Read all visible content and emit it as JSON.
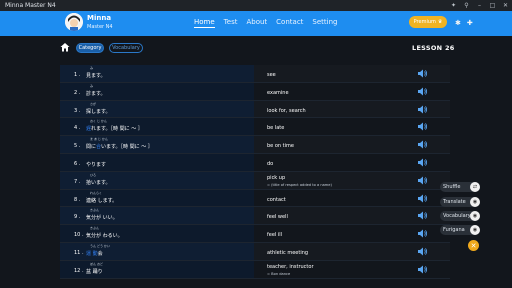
{
  "window": {
    "title": "Minna Master N4",
    "controls": [
      "puzzle-icon",
      "pin-icon",
      "minimize-icon",
      "maximize-icon",
      "close-icon"
    ]
  },
  "header": {
    "name": "Minna",
    "subtitle": "Master N4",
    "nav": [
      "Home",
      "Test",
      "About",
      "Contact",
      "Setting"
    ],
    "active_nav": "Home",
    "premium_label": "Premium",
    "accent_color": "#1e8df0",
    "premium_color": "#f0b323"
  },
  "toolbar": {
    "category_label": "Category",
    "vocabulary_label": "Vocabulary",
    "lesson_label": "LESSON  26"
  },
  "rows": [
    {
      "num": "1 .",
      "jp": "見ます。",
      "ruby": "み",
      "en": "see",
      "en_sub": ""
    },
    {
      "num": "2 .",
      "jp": "診ます。",
      "ruby": "み",
      "en": "examine",
      "en_sub": ""
    },
    {
      "num": "3 .",
      "jp": "探します。",
      "ruby": "さが",
      "en": "look for, search",
      "en_sub": ""
    },
    {
      "num": "4 .",
      "jp_pre": "",
      "jp_hl": "遅",
      "jp": "れます。［時 間に ～ ］",
      "ruby": "おく      じ  かん",
      "en": "be late",
      "en_sub": ""
    },
    {
      "num": "5 .",
      "jp_pre": "間に",
      "jp_hl": "合",
      "jp": "います。［時 間に ～ ］",
      "ruby": "ま   あ       じ  かん",
      "en": "be on time",
      "en_sub": ""
    },
    {
      "num": "6 .",
      "jp": "やります",
      "ruby": "",
      "en": "do",
      "en_sub": ""
    },
    {
      "num": "7 .",
      "jp": "拾います。",
      "ruby": "ひろ",
      "en": "pick up",
      "en_sub": "= (title of respect added to a name)"
    },
    {
      "num": "8 .",
      "jp": "連絡 します。",
      "ruby": "れんらく",
      "en": "contact",
      "en_sub": ""
    },
    {
      "num": "9 .",
      "jp": "気分が いい。",
      "ruby": "きぶん",
      "en": "feel well",
      "en_sub": ""
    },
    {
      "num": "10 .",
      "jp": "気分が わるい。",
      "ruby": "きぶん",
      "en": "feel ill",
      "en_sub": ""
    },
    {
      "num": "11 .",
      "jp_hl": "運 動",
      "jp": "会",
      "ruby": "うん どう かい",
      "en": "athletic meeting",
      "en_sub": ""
    },
    {
      "num": "12 .",
      "jp": "盆 踊り",
      "ruby": "ぼん おど",
      "en": "teacher, instructor",
      "en_sub": "= Bon dance"
    }
  ],
  "fabs": [
    {
      "label": "Shuffle",
      "icon": "shuffle-icon"
    },
    {
      "label": "Translate",
      "icon": "eye-icon"
    },
    {
      "label": "Vocabulary",
      "icon": "eye-icon"
    },
    {
      "label": "Furigana",
      "icon": "eye-icon"
    }
  ],
  "fab_close_icon": "close-icon"
}
